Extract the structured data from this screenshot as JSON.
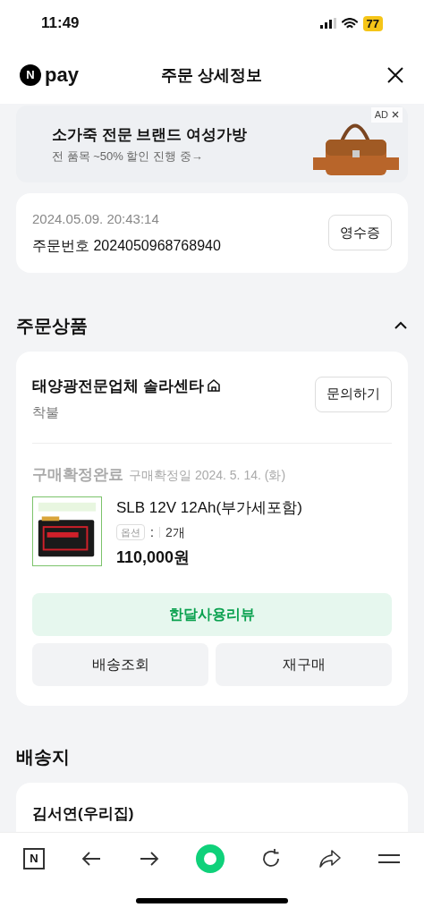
{
  "status_bar": {
    "time": "11:49",
    "battery": "77"
  },
  "header": {
    "logo_mark": "N",
    "logo_text": "pay",
    "title": "주문 상세정보"
  },
  "ad": {
    "headline": "소가죽 전문 브랜드 여성가방",
    "subline": "전 품목 ~50% 할인 진행 중→",
    "badge": "AD"
  },
  "order": {
    "datetime": "2024.05.09. 20:43:14",
    "order_number": "주문번호 2024050968768940",
    "receipt_button": "영수증"
  },
  "products_section": {
    "title": "주문상품",
    "expanded": true,
    "seller": {
      "name": "태양광전문업체 솔라센타",
      "shipping": "착불",
      "inquiry_button": "문의하기"
    },
    "item": {
      "status": "구매확정완료",
      "confirm_date": "구매확정일 2024. 5. 14. (화)",
      "name": "SLB 12V 12Ah(부가세포함)",
      "option_label": "옵션",
      "option_sep": ":",
      "quantity": "2개",
      "price": "110,000원"
    },
    "buttons": [
      {
        "label": "한달사용리뷰",
        "kind": "primary"
      },
      {
        "label": "배송조회",
        "kind": "secondary"
      },
      {
        "label": "재구매",
        "kind": "secondary"
      }
    ]
  },
  "shipping_section": {
    "title": "배송지",
    "recipient": "김서연(우리집)"
  },
  "toolbar": {
    "home_key": "N"
  }
}
